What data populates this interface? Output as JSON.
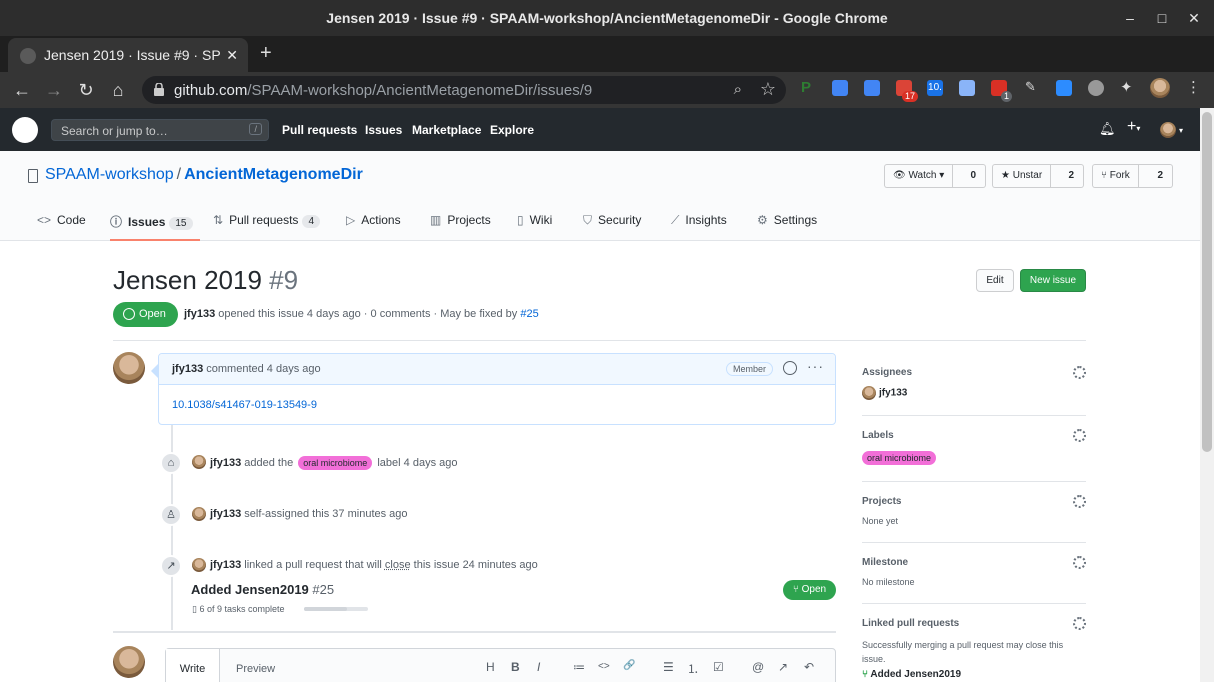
{
  "window": {
    "title": "Jensen 2019 · Issue #9 · SPAAM-workshop/AncientMetagenomeDir - Google Chrome"
  },
  "browser": {
    "tab_title": "Jensen 2019 · Issue #9 · SP",
    "url_host": "github.com",
    "url_path": "/SPAAM-workshop/AncientMetagenomeDir/issues/9",
    "ext_badge_gmail": "17",
    "ext_badge_other": "1",
    "ext_doi": "10."
  },
  "github": {
    "search_placeholder": "Search or jump to…",
    "search_shortcut": "/",
    "nav": [
      "Pull requests",
      "Issues",
      "Marketplace",
      "Explore"
    ],
    "plus": "+"
  },
  "repo": {
    "owner": "SPAAM-workshop",
    "separator": "/",
    "name": "AncientMetagenomeDir",
    "watch_label": "Watch",
    "watch_count": "0",
    "unstar_label": "Unstar",
    "star_count": "2",
    "fork_label": "Fork",
    "fork_count": "2",
    "tabs": {
      "code": "Code",
      "issues": "Issues",
      "issues_count": "15",
      "pulls": "Pull requests",
      "pulls_count": "4",
      "actions": "Actions",
      "projects": "Projects",
      "wiki": "Wiki",
      "security": "Security",
      "insights": "Insights",
      "settings": "Settings"
    }
  },
  "issue": {
    "title": "Jensen 2019",
    "number": "#9",
    "edit_label": "Edit",
    "new_issue_label": "New issue",
    "state": "Open",
    "author": "jfy133",
    "opened_text": "opened this issue 4 days ago · 0 comments · May be fixed by",
    "fixed_by": "#25"
  },
  "comment": {
    "author": "jfy133",
    "when": "commented 4 days ago",
    "role": "Member",
    "body_link": "10.1038/s41467-019-13549-9",
    "more": "···"
  },
  "timeline": {
    "event1": {
      "actor": "jfy133",
      "pre": "added the",
      "label": "oral microbiome",
      "post": "label 4 days ago",
      "label_color": "#f26fd8"
    },
    "event2": {
      "actor": "jfy133",
      "text": "self-assigned this 37 minutes ago"
    },
    "event3": {
      "actor": "jfy133",
      "pre": "linked a pull request that will",
      "close": "close",
      "post": "this issue 24 minutes ago",
      "pr_title": "Added Jensen2019",
      "pr_number": "#25",
      "pr_state": "Open",
      "tasks": "6 of 9 tasks complete",
      "task_progress": 0.67
    }
  },
  "composer": {
    "write_tab": "Write",
    "preview_tab": "Preview",
    "tools": [
      "H",
      "B",
      "I",
      "≔",
      "<>",
      "🔗",
      "☰",
      "⒈",
      "☑",
      "@",
      "↗",
      "↶"
    ]
  },
  "sidebar": {
    "assignees_title": "Assignees",
    "assignee": "jfy133",
    "labels_title": "Labels",
    "label": "oral microbiome",
    "projects_title": "Projects",
    "projects_value": "None yet",
    "milestone_title": "Milestone",
    "milestone_value": "No milestone",
    "linked_title": "Linked pull requests",
    "linked_desc": "Successfully merging a pull request may close this issue.",
    "linked_pr": "Added Jensen2019"
  },
  "colors": {
    "accent_green": "#2ea44f",
    "link_blue": "#0366d6",
    "active_tab": "#f9826c",
    "label_pink": "#f26fd8"
  }
}
